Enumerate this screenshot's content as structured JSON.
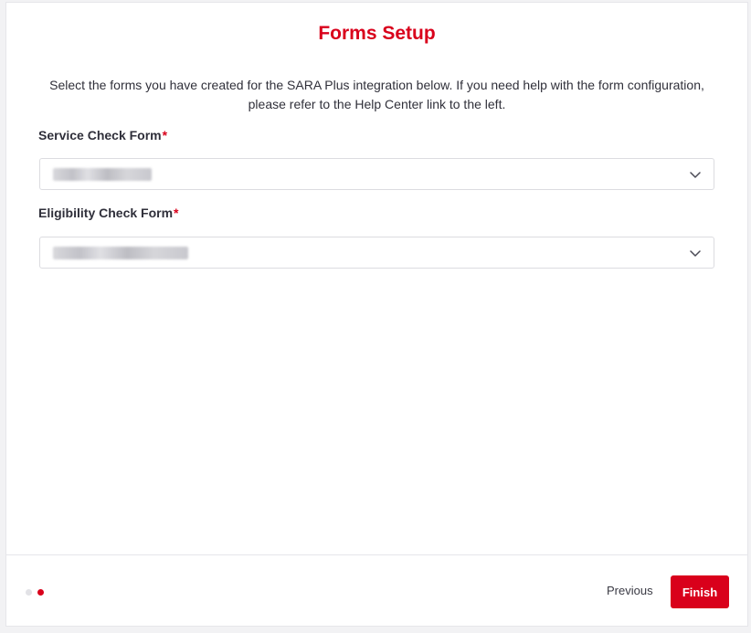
{
  "header": {
    "title": "Forms Setup"
  },
  "intro": {
    "line1": "Select the forms you have created for the SARA Plus integration below. If you need help with the form configuration,",
    "line2": "please refer to the Help Center link to the left."
  },
  "fields": [
    {
      "label": "Service Check Form",
      "required_mark": "*",
      "value": "",
      "icon": "chevron-down-icon"
    },
    {
      "label": "Eligibility Check Form",
      "required_mark": "*",
      "value": "",
      "icon": "chevron-down-icon"
    }
  ],
  "steps": {
    "total": 2,
    "current": 2
  },
  "footer": {
    "previous_label": "Previous",
    "finish_label": "Finish"
  },
  "colors": {
    "accent": "#d9001b",
    "dot_inactive": "#e2e2e6"
  }
}
